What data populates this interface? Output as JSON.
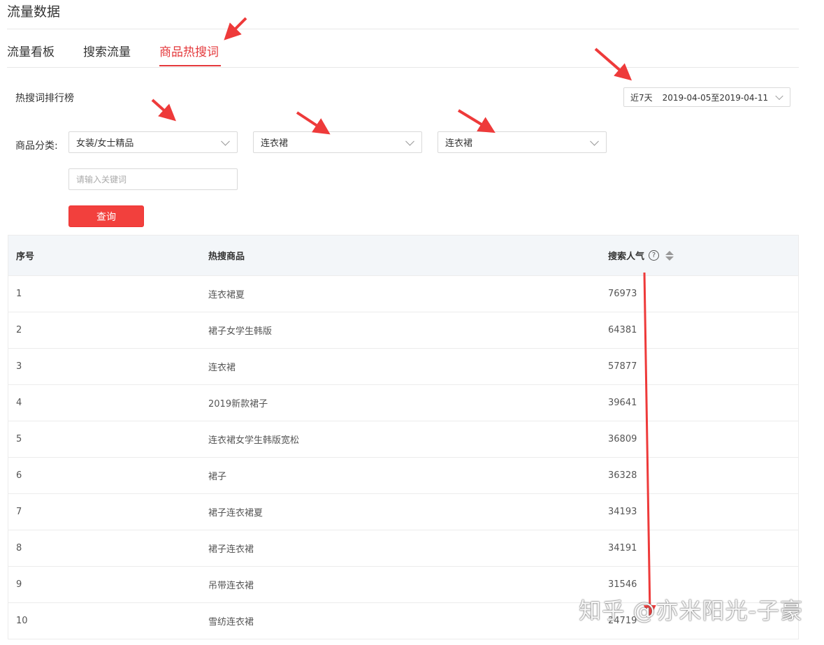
{
  "page": {
    "title": "流量数据"
  },
  "tabs": [
    {
      "label": "流量看板",
      "active": false
    },
    {
      "label": "搜索流量",
      "active": false
    },
    {
      "label": "商品热搜词",
      "active": true
    }
  ],
  "section": {
    "title": "热搜词排行榜"
  },
  "date_filter": {
    "period": "近7天",
    "range": "2019-04-05至2019-04-11"
  },
  "filters": {
    "category_label": "商品分类:",
    "category_1": "女装/女士精品",
    "category_2": "连衣裙",
    "category_3": "连衣裙",
    "keyword_placeholder": "请输入关键词",
    "query_button": "查询"
  },
  "table": {
    "headers": {
      "index": "序号",
      "product": "热搜商品",
      "popularity": "搜索人气"
    },
    "rows": [
      {
        "index": "1",
        "product": "连衣裙夏",
        "popularity": "76973"
      },
      {
        "index": "2",
        "product": "裙子女学生韩版",
        "popularity": "64381"
      },
      {
        "index": "3",
        "product": "连衣裙",
        "popularity": "57877"
      },
      {
        "index": "4",
        "product": "2019新款裙子",
        "popularity": "39641"
      },
      {
        "index": "5",
        "product": "连衣裙女学生韩版宽松",
        "popularity": "36809"
      },
      {
        "index": "6",
        "product": "裙子",
        "popularity": "36328"
      },
      {
        "index": "7",
        "product": "裙子连衣裙夏",
        "popularity": "34193"
      },
      {
        "index": "8",
        "product": "裙子连衣裙",
        "popularity": "34191"
      },
      {
        "index": "9",
        "product": "吊带连衣裙",
        "popularity": "31546"
      },
      {
        "index": "10",
        "product": "雪纺连衣裙",
        "popularity": "24719"
      }
    ]
  },
  "watermark": "知乎 @亦米阳光-子豪",
  "colors": {
    "accent": "#e4393c",
    "button": "#f2403d",
    "annotation_arrow": "#ee3a3a"
  },
  "icons": {
    "help": "question-circle-icon",
    "sort": "sort-icon",
    "dropdown": "chevron-down-icon"
  }
}
